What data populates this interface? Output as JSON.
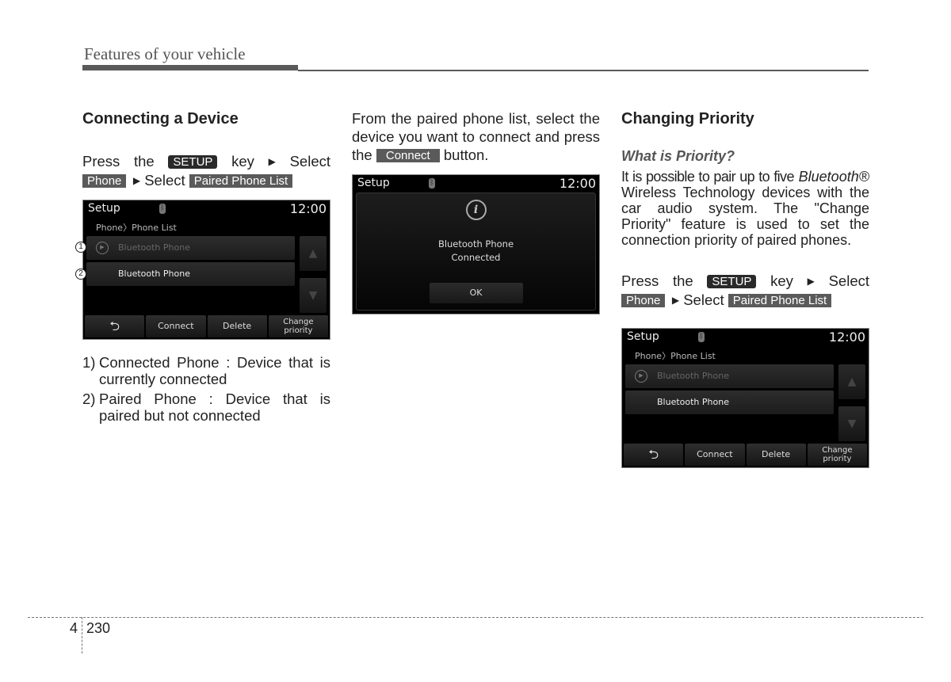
{
  "header": {
    "title": "Features of your vehicle"
  },
  "keys": {
    "setup": "SETUP",
    "phone": "Phone",
    "paired_phone_list": "Paired Phone List",
    "connect": "Connect"
  },
  "col1": {
    "heading": "Connecting a Device",
    "press_the": "Press the",
    "key_word": "key",
    "select": "Select",
    "notes": [
      {
        "num": "1)",
        "text": "Connected Phone : Device that is currently connected"
      },
      {
        "num": "2)",
        "text": "Paired Phone : Device that is paired but not connected"
      }
    ]
  },
  "col2": {
    "line1": "From the paired phone list, select the device you want to connect and",
    "press_the": "press the",
    "button_word": "button."
  },
  "col3": {
    "heading": "Changing Priority",
    "subheading": "What is Priority?",
    "para_start": "It is possible to pair up to five",
    "bluetooth": "Bluetooth®",
    "para_end": "Wireless Technology devices with the car audio system. The \"Change Priority\" feature is used to set the connection priority of paired phones.",
    "press_the": "Press the",
    "key_word": "key",
    "select": "Select"
  },
  "screen_list": {
    "title": "Setup",
    "bt_icon": "bluetooth-icon",
    "time": "12:00",
    "breadcrumb": "Phone〉Phone List",
    "rows": [
      "Bluetooth Phone",
      "Bluetooth Phone"
    ],
    "scroll_up": "▲",
    "scroll_down": "▼",
    "buttons": {
      "back": "⮌",
      "connect": "Connect",
      "delete": "Delete",
      "change_priority_1": "Change",
      "change_priority_2": "priority"
    },
    "callouts": [
      "1",
      "2"
    ]
  },
  "screen_dialog": {
    "title": "Setup",
    "time": "12:00",
    "info_icon": "i",
    "message_1": "Bluetooth Phone",
    "message_2": "Connected",
    "ok": "OK"
  },
  "footer": {
    "chapter": "4",
    "page": "230"
  }
}
